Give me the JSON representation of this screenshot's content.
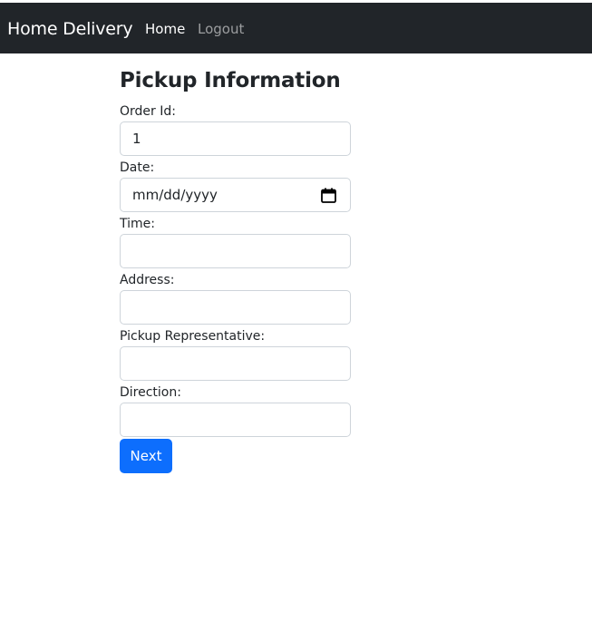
{
  "navbar": {
    "brand": "Home Delivery",
    "links": [
      {
        "label": "Home",
        "active": true
      },
      {
        "label": "Logout",
        "active": false
      }
    ]
  },
  "form": {
    "title": "Pickup Information",
    "fields": [
      {
        "label": "Order Id:",
        "value": "1"
      },
      {
        "label": "Date:",
        "value": "mm/dd/yyyy",
        "icon": "calendar-icon"
      },
      {
        "label": "Time:",
        "value": ""
      },
      {
        "label": "Address:",
        "value": ""
      },
      {
        "label": "Pickup Representative:",
        "value": ""
      },
      {
        "label": "Direction:",
        "value": ""
      }
    ],
    "submit_label": "Next"
  },
  "colors": {
    "navbar_bg": "#212529",
    "primary_button": "#0d6efd",
    "input_border": "#ced4da"
  }
}
